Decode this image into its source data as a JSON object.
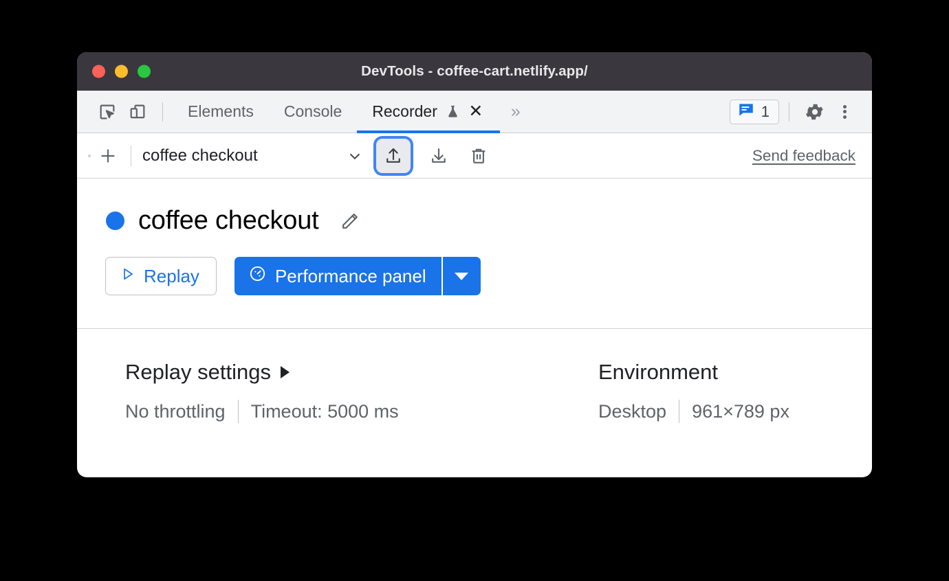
{
  "window": {
    "title": "DevTools - coffee-cart.netlify.app/",
    "traffic_lights": [
      {
        "name": "close",
        "color": "#ff6058"
      },
      {
        "name": "minimize",
        "color": "#ffbd2e"
      },
      {
        "name": "zoom",
        "color": "#28c840"
      }
    ]
  },
  "tabbar": {
    "inspect_icon": "inspect-element-icon",
    "device_icon": "device-toolbar-icon",
    "tabs": [
      {
        "label": "Elements",
        "active": false
      },
      {
        "label": "Console",
        "active": false
      },
      {
        "label": "Recorder",
        "active": true,
        "experimental": true,
        "closable": true
      }
    ],
    "more_tabs": "»",
    "issues": {
      "icon": "issues-icon",
      "count": "1"
    },
    "settings_icon": "gear-icon",
    "menu_icon": "kebab-menu-icon"
  },
  "recorder_toolbar": {
    "add_label": "+",
    "selected_recording": "coffee checkout",
    "chevron": "⌄",
    "import_label": "import-icon",
    "export_label": "export-icon",
    "delete_label": "delete-icon",
    "feedback_label": "Send feedback"
  },
  "recording": {
    "status_color": "#1a73e8",
    "title": "coffee checkout",
    "edit_icon": "pencil-icon"
  },
  "actions": {
    "replay_label": "Replay",
    "replay_icon": "play-icon",
    "performance_label": "Performance panel",
    "performance_icon": "performance-gauge-icon",
    "performance_more": "chevron-down-icon"
  },
  "replay_settings": {
    "title": "Replay settings",
    "expander": "▶",
    "throttling": "No throttling",
    "timeout": "Timeout: 5000 ms"
  },
  "environment": {
    "title": "Environment",
    "device": "Desktop",
    "viewport": "961×789 px"
  },
  "colors": {
    "accent": "#1a73e8",
    "titlebar": "#3b373f",
    "tabbar": "#f1f3f4",
    "text": "#202124",
    "muted": "#5f6368"
  }
}
